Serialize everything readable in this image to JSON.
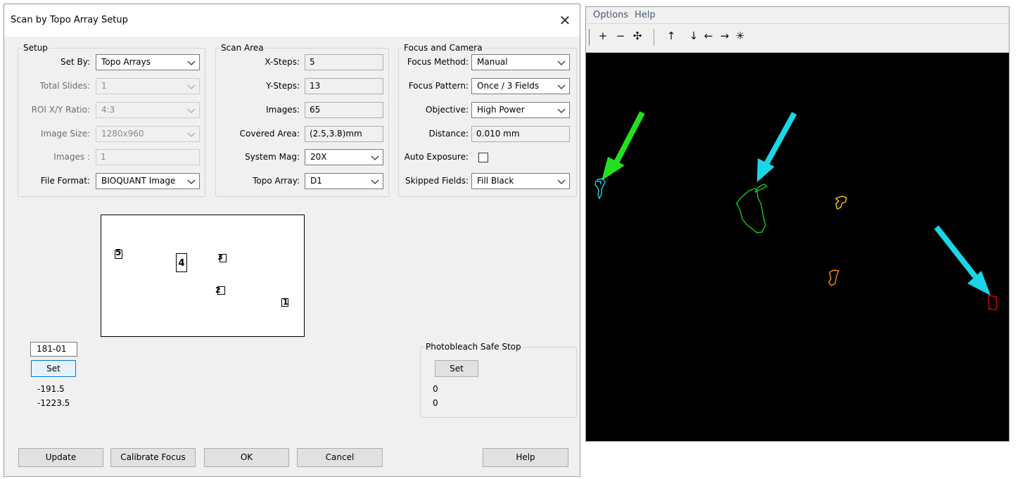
{
  "dialog": {
    "title": "Scan by Topo Array Setup",
    "close_glyph": "✕",
    "setup": {
      "legend": "Setup",
      "set_by_label": "Set By:",
      "set_by_value": "Topo Arrays",
      "total_slides_label": "Total Slides:",
      "total_slides_value": "1",
      "roi_ratio_label": "ROI X/Y Ratio:",
      "roi_ratio_value": "4:3",
      "image_size_label": "Image Size:",
      "image_size_value": "1280x960",
      "images_label": "Images :",
      "images_value": "1",
      "file_format_label": "File Format:",
      "file_format_value": "BIOQUANT Image"
    },
    "scan_area": {
      "legend": "Scan Area",
      "x_steps_label": "X-Steps:",
      "x_steps_value": "5",
      "y_steps_label": "Y-Steps:",
      "y_steps_value": "13",
      "images_label": "Images:",
      "images_value": "65",
      "covered_area_label": "Covered Area:",
      "covered_area_value": "(2.5,3.8)mm",
      "system_mag_label": "System Mag:",
      "system_mag_value": "20X",
      "topo_array_label": "Topo Array:",
      "topo_array_value": "D1"
    },
    "focus_camera": {
      "legend": "Focus and Camera",
      "focus_method_label": "Focus Method:",
      "focus_method_value": "Manual",
      "focus_pattern_label": "Focus Pattern:",
      "focus_pattern_value": "Once / 3 Fields",
      "objective_label": "Objective:",
      "objective_value": "High Power",
      "distance_label": "Distance:",
      "distance_value": "0.010 mm",
      "auto_exposure_label": "Auto Exposure:",
      "skipped_fields_label": "Skipped Fields:",
      "skipped_fields_value": "Fill Black"
    },
    "preview_markers": [
      "5",
      "4",
      "3",
      "2",
      "1"
    ],
    "slide_input_value": "181-01",
    "set_label": "Set",
    "coord_x": "-191.5",
    "coord_y": "-1223.5",
    "photobleach": {
      "legend": "Photobleach Safe Stop",
      "set_label": "Set",
      "value1": "0",
      "value2": "0"
    },
    "buttons": {
      "update": "Update",
      "calibrate_focus": "Calibrate Focus",
      "ok": "OK",
      "cancel": "Cancel",
      "help": "Help"
    }
  },
  "viewer": {
    "menu": {
      "options": "Options",
      "help": "Help"
    },
    "toolbar": {
      "plus": "+",
      "minus": "−",
      "center": "✣",
      "up": "↑",
      "down": "↓",
      "left": "←",
      "right": "→",
      "target": "✳"
    },
    "colors": {
      "arrow_green": "#22e01e",
      "arrow_cyan": "#19d6e8",
      "outline_cyan": "#19d6e8",
      "outline_green": "#1ec81e",
      "outline_yellow": "#f4d000",
      "outline_orange": "#ff8c10",
      "outline_red": "#e00000"
    }
  }
}
